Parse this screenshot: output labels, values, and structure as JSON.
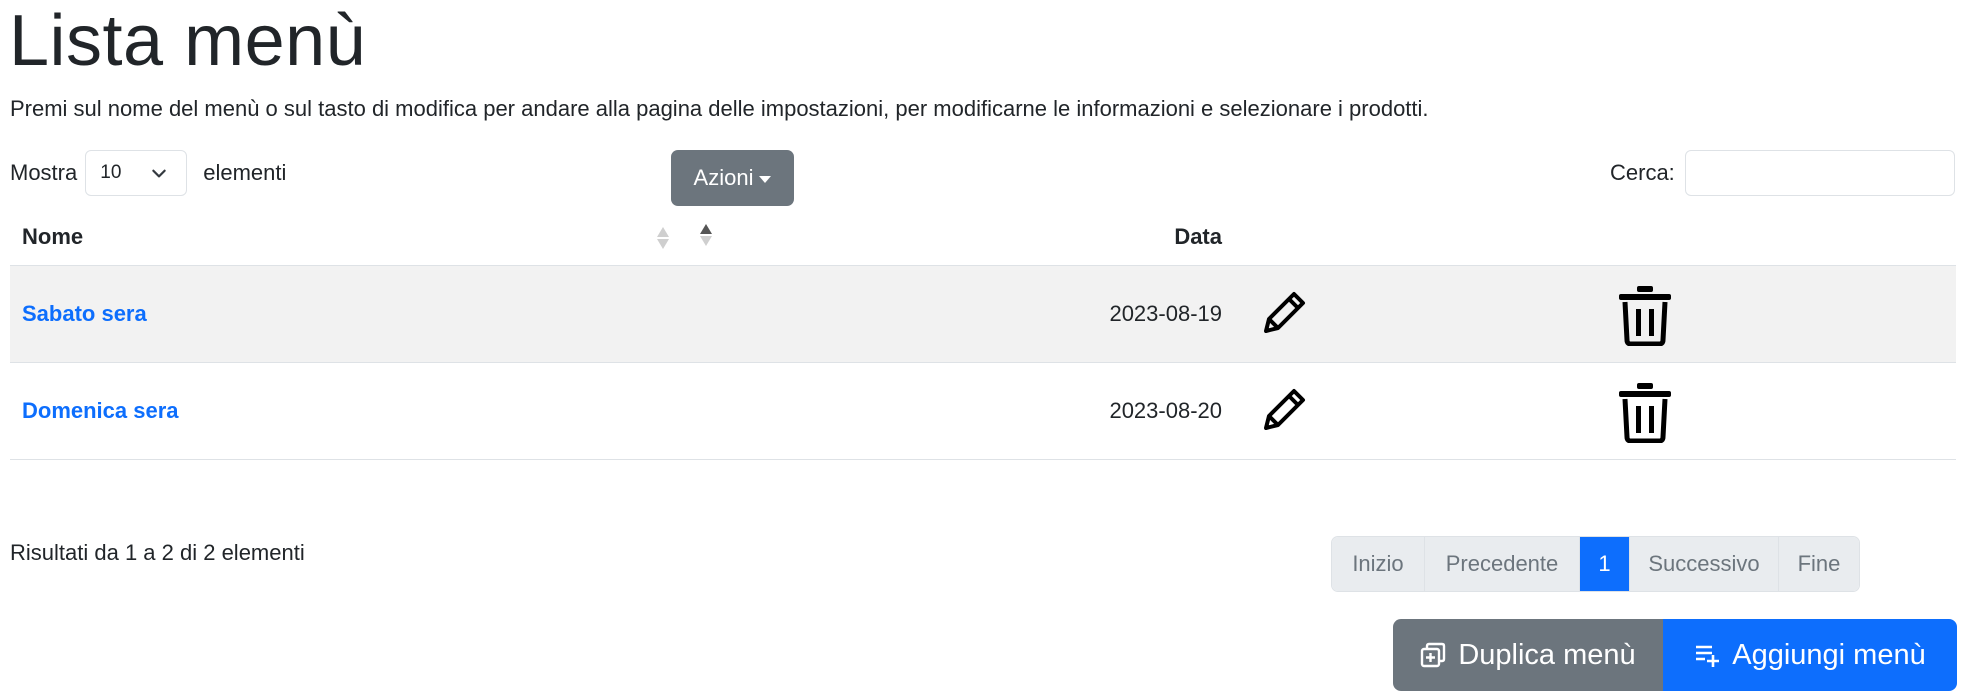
{
  "header": {
    "title": "Lista menù",
    "description": "Premi sul nome del menù o sul tasto di modifica per andare alla pagina delle impostazioni, per modificarne le informazioni e selezionare i prodotti."
  },
  "controls": {
    "length_before": "Mostra",
    "length_value": "10",
    "length_after": "elementi",
    "actions_label": "Azioni",
    "search_label": "Cerca:",
    "search_value": ""
  },
  "table": {
    "columns": [
      "Nome",
      "Data"
    ],
    "rows": [
      {
        "name": "Sabato sera",
        "date": "2023-08-19"
      },
      {
        "name": "Domenica sera",
        "date": "2023-08-20"
      }
    ]
  },
  "footer": {
    "info": "Risultati da 1 a 2 di 2 elementi",
    "pagination": {
      "first": "Inizio",
      "prev": "Precedente",
      "current": "1",
      "next": "Successivo",
      "last": "Fine"
    }
  },
  "buttons": {
    "duplicate": "Duplica menù",
    "add": "Aggiungi menù"
  },
  "icons": {
    "select": "chevron-down-icon",
    "actions": "caret-down-icon",
    "sort_neutral": "sort-both-icon",
    "sort_asc": "sort-asc-icon",
    "edit": "pencil-icon",
    "delete": "trash-icon",
    "duplicate": "duplicate-icon",
    "add": "playlist-add-icon"
  },
  "colors": {
    "primary": "#0d6efd",
    "secondary": "#6c757d",
    "link": "#0d6efd",
    "striped_row": "#f2f2f2",
    "pagination_disabled": "#e9ecef"
  }
}
